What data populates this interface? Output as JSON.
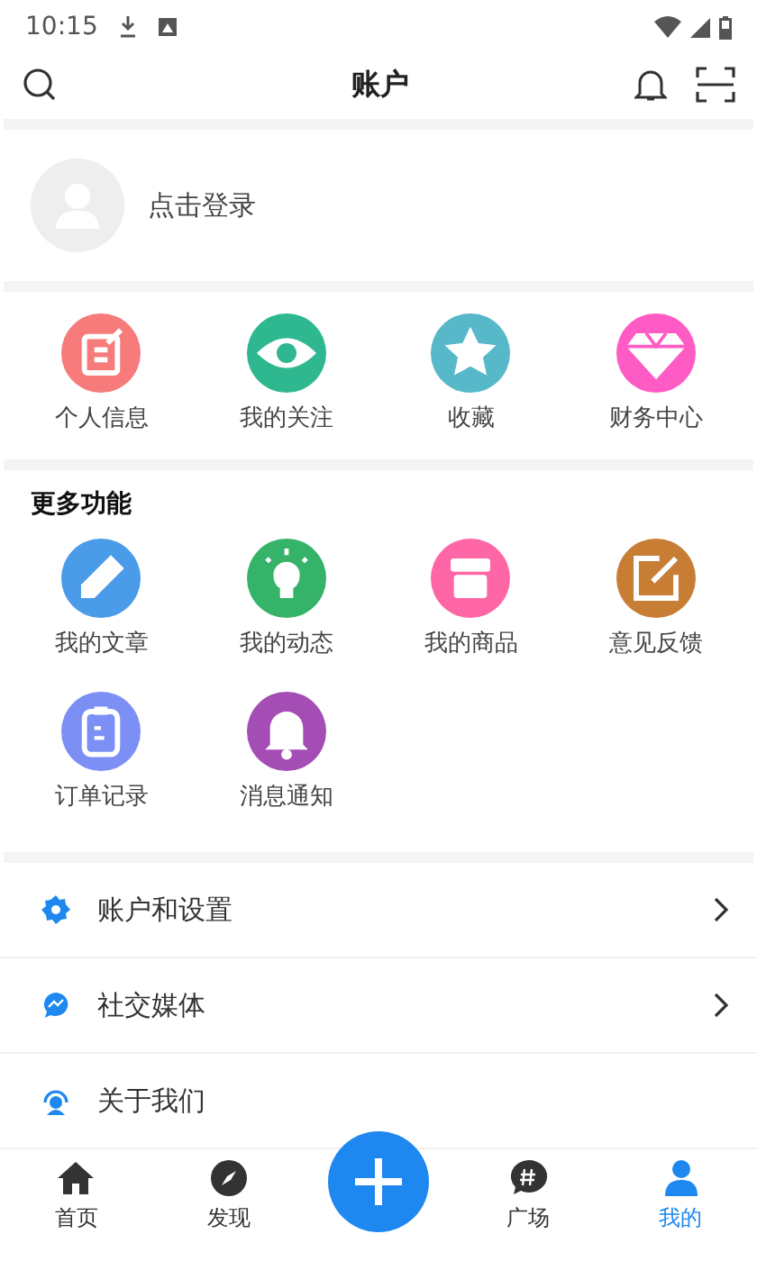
{
  "status_bar": {
    "time": "10:15"
  },
  "header": {
    "title": "账户"
  },
  "login": {
    "label": "点击登录"
  },
  "shortcuts": [
    {
      "label": "个人信息",
      "color": "#f77b7b"
    },
    {
      "label": "我的关注",
      "color": "#2fb88f"
    },
    {
      "label": "收藏",
      "color": "#56b8c9"
    },
    {
      "label": "财务中心",
      "color": "#ff5bc4"
    }
  ],
  "more": {
    "title": "更多功能",
    "items": [
      {
        "label": "我的文章",
        "color": "#4a9be8"
      },
      {
        "label": "我的动态",
        "color": "#35b368"
      },
      {
        "label": "我的商品",
        "color": "#ff66a6"
      },
      {
        "label": "意见反馈",
        "color": "#c77d34"
      },
      {
        "label": "订单记录",
        "color": "#7b8ff5"
      },
      {
        "label": "消息通知",
        "color": "#a34db5"
      }
    ]
  },
  "menu": [
    {
      "label": "账户和设置",
      "chevron": true
    },
    {
      "label": "社交媒体",
      "chevron": true
    },
    {
      "label": "关于我们",
      "chevron": false
    }
  ],
  "bottom_nav": {
    "tabs": [
      {
        "label": "首页",
        "selected": false
      },
      {
        "label": "发现",
        "selected": false
      },
      {
        "label": "广场",
        "selected": false
      },
      {
        "label": "我的",
        "selected": true
      }
    ]
  }
}
